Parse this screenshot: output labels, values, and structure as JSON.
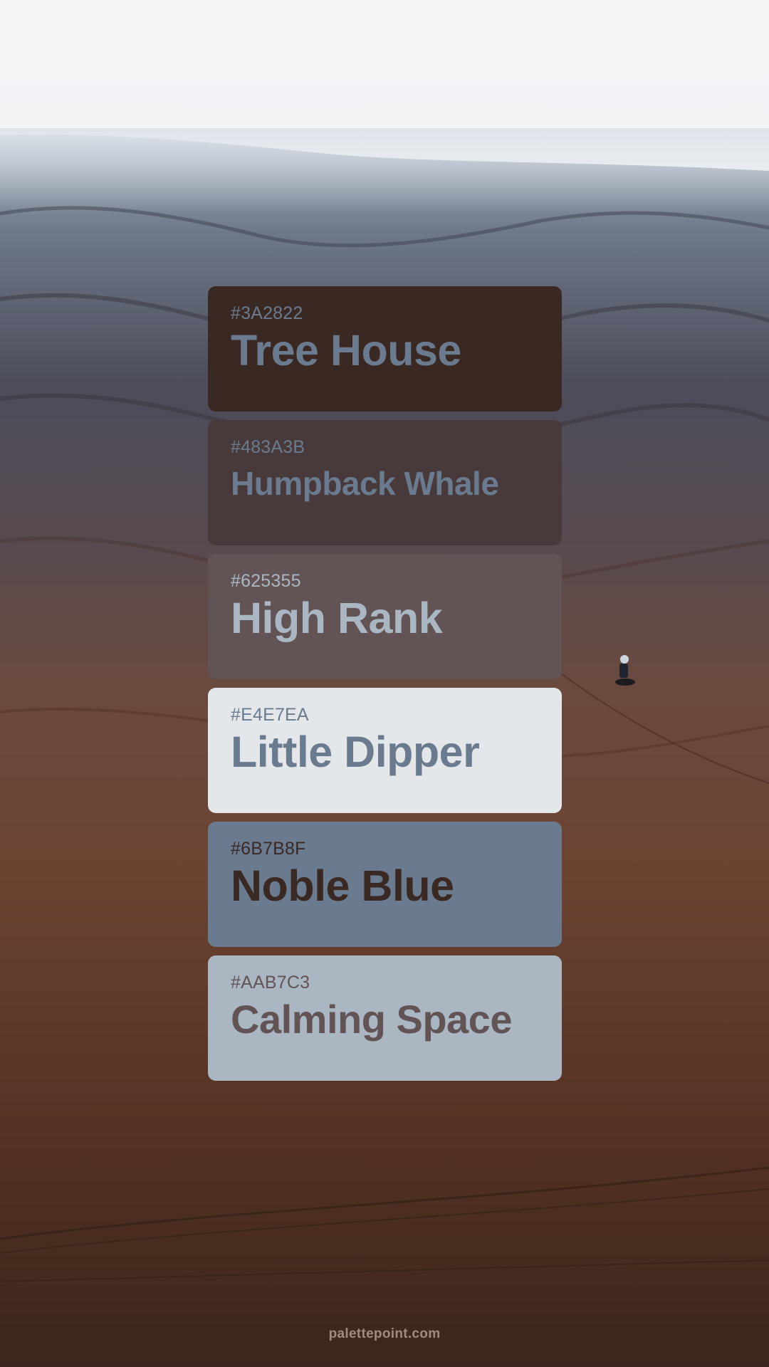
{
  "colors": {
    "sky": "#f4f5f7",
    "haze": "#c9d1dc",
    "dune_shadow": "#4a4a5a",
    "sand": "#6e4532",
    "sand_dark": "#3a2620"
  },
  "swatches": [
    {
      "hex": "#3A2822",
      "name": "Tree House",
      "bg": "#3A2822",
      "text_color": "#6B7B8F"
    },
    {
      "hex": "#483A3B",
      "name": "Humpback Whale",
      "bg": "#483A3B",
      "text_color": "#6B7B8F"
    },
    {
      "hex": "#625355",
      "name": "High Rank",
      "bg": "#625355",
      "text_color": "#AAB7C3"
    },
    {
      "hex": "#E4E7EA",
      "name": "Little Dipper",
      "bg": "#E4E7EA",
      "text_color": "#6B7B8F"
    },
    {
      "hex": "#6B7B8F",
      "name": "Noble Blue",
      "bg": "#6B7B8F",
      "text_color": "#3A2822"
    },
    {
      "hex": "#AAB7C3",
      "name": "Calming Space",
      "bg": "#AAB7C3",
      "text_color": "#625355"
    }
  ],
  "footer": {
    "site": "palettepoint.com"
  }
}
